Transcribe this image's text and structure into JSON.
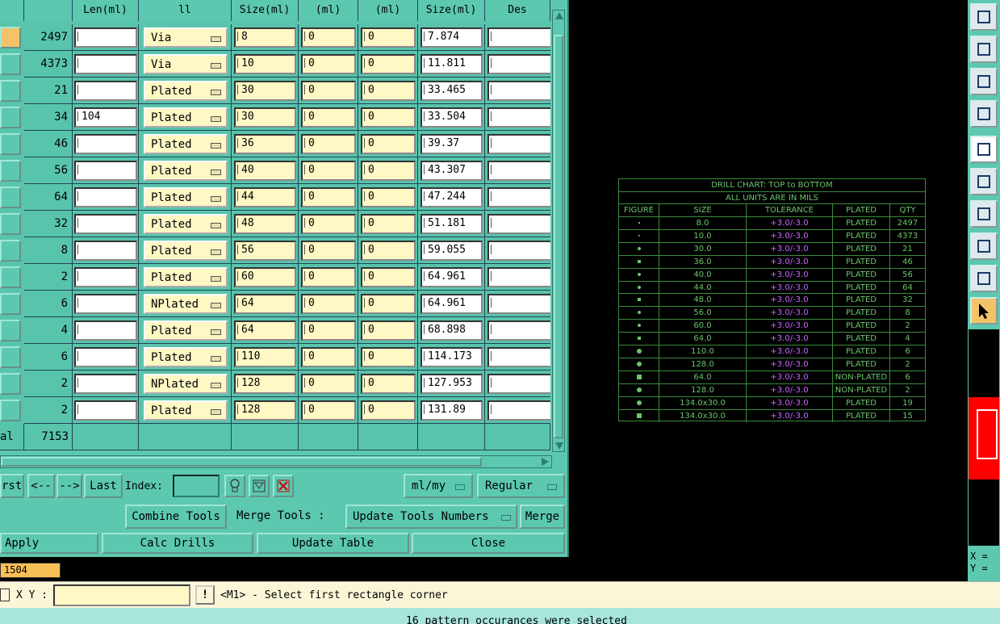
{
  "columns": [
    "",
    "",
    "Len(ml)",
    "ll",
    "Size(ml)",
    "(ml)",
    "(ml)",
    "Size(ml)",
    "Des"
  ],
  "rows": [
    {
      "qty": "2497",
      "len": "",
      "type": "Via",
      "size": "8",
      "tolp": "0",
      "tolm": "0",
      "fin": "7.874",
      "des": ""
    },
    {
      "qty": "4373",
      "len": "",
      "type": "Via",
      "size": "10",
      "tolp": "0",
      "tolm": "0",
      "fin": "11.811",
      "des": ""
    },
    {
      "qty": "21",
      "len": "",
      "type": "Plated",
      "size": "30",
      "tolp": "0",
      "tolm": "0",
      "fin": "33.465",
      "des": ""
    },
    {
      "qty": "34",
      "len": "104",
      "type": "Plated",
      "size": "30",
      "tolp": "0",
      "tolm": "0",
      "fin": "33.504",
      "des": ""
    },
    {
      "qty": "46",
      "len": "",
      "type": "Plated",
      "size": "36",
      "tolp": "0",
      "tolm": "0",
      "fin": "39.37",
      "des": ""
    },
    {
      "qty": "56",
      "len": "",
      "type": "Plated",
      "size": "40",
      "tolp": "0",
      "tolm": "0",
      "fin": "43.307",
      "des": ""
    },
    {
      "qty": "64",
      "len": "",
      "type": "Plated",
      "size": "44",
      "tolp": "0",
      "tolm": "0",
      "fin": "47.244",
      "des": ""
    },
    {
      "qty": "32",
      "len": "",
      "type": "Plated",
      "size": "48",
      "tolp": "0",
      "tolm": "0",
      "fin": "51.181",
      "des": ""
    },
    {
      "qty": "8",
      "len": "",
      "type": "Plated",
      "size": "56",
      "tolp": "0",
      "tolm": "0",
      "fin": "59.055",
      "des": ""
    },
    {
      "qty": "2",
      "len": "",
      "type": "Plated",
      "size": "60",
      "tolp": "0",
      "tolm": "0",
      "fin": "64.961",
      "des": ""
    },
    {
      "qty": "6",
      "len": "",
      "type": "NPlated",
      "size": "64",
      "tolp": "0",
      "tolm": "0",
      "fin": "64.961",
      "des": ""
    },
    {
      "qty": "4",
      "len": "",
      "type": "Plated",
      "size": "64",
      "tolp": "0",
      "tolm": "0",
      "fin": "68.898",
      "des": ""
    },
    {
      "qty": "6",
      "len": "",
      "type": "Plated",
      "size": "110",
      "tolp": "0",
      "tolm": "0",
      "fin": "114.173",
      "des": ""
    },
    {
      "qty": "2",
      "len": "",
      "type": "NPlated",
      "size": "128",
      "tolp": "0",
      "tolm": "0",
      "fin": "127.953",
      "des": ""
    },
    {
      "qty": "2",
      "len": "",
      "type": "Plated",
      "size": "128",
      "tolp": "0",
      "tolm": "0",
      "fin": "131.89",
      "des": ""
    }
  ],
  "total": {
    "label": "al",
    "value": "7153"
  },
  "nav": {
    "first": "rst",
    "prev": "<--",
    "next": "-->",
    "last": "Last",
    "index_label": "Index:",
    "index_value": "",
    "units": "ml/my",
    "mode": "Regular"
  },
  "tools": {
    "combine": "Combine Tools",
    "merge_label": "Merge Tools :",
    "update_numbers": "Update Tools Numbers",
    "merge": "Merge"
  },
  "actions": {
    "apply": "Apply",
    "calc": "Calc Drills",
    "update_table": "Update Table",
    "close": "Close"
  },
  "orange_value": "1504",
  "xy": {
    "label": "X Y :",
    "value": ""
  },
  "prompt": "<M1> - Select first rectangle corner",
  "status": "16 pattern occurances were selected",
  "coords": {
    "x": "X =",
    "y": "Y ="
  },
  "drill_chart": {
    "title1": "DRILL CHART: TOP to BOTTOM",
    "title2": "ALL UNITS ARE IN MILS",
    "headers": [
      "FIGURE",
      "SIZE",
      "TOLERANCE",
      "PLATED",
      "QTY"
    ],
    "rows": [
      {
        "size": "8.0",
        "tol": "+3.0/-3.0",
        "plated": "PLATED",
        "qty": "2497"
      },
      {
        "size": "10.0",
        "tol": "+3.0/-3.0",
        "plated": "PLATED",
        "qty": "4373"
      },
      {
        "size": "30.0",
        "tol": "+3.0/-3.0",
        "plated": "PLATED",
        "qty": "21"
      },
      {
        "size": "36.0",
        "tol": "+3.0/-3.0",
        "plated": "PLATED",
        "qty": "46"
      },
      {
        "size": "40.0",
        "tol": "+3.0/-3.0",
        "plated": "PLATED",
        "qty": "56"
      },
      {
        "size": "44.0",
        "tol": "+3.0/-3.0",
        "plated": "PLATED",
        "qty": "64"
      },
      {
        "size": "48.0",
        "tol": "+3.0/-3.0",
        "plated": "PLATED",
        "qty": "32"
      },
      {
        "size": "56.0",
        "tol": "+3.0/-3.0",
        "plated": "PLATED",
        "qty": "8"
      },
      {
        "size": "60.0",
        "tol": "+3.0/-3.0",
        "plated": "PLATED",
        "qty": "2"
      },
      {
        "size": "64.0",
        "tol": "+3.0/-3.0",
        "plated": "PLATED",
        "qty": "4"
      },
      {
        "size": "110.0",
        "tol": "+3.0/-3.0",
        "plated": "PLATED",
        "qty": "6"
      },
      {
        "size": "128.0",
        "tol": "+3.0/-3.0",
        "plated": "PLATED",
        "qty": "2"
      },
      {
        "size": "64.0",
        "tol": "+3.0/-3.0",
        "plated": "NON-PLATED",
        "qty": "6"
      },
      {
        "size": "128.0",
        "tol": "+3.0/-3.0",
        "plated": "NON-PLATED",
        "qty": "2"
      },
      {
        "size": "134.0x30.0",
        "tol": "+3.0/-3.0",
        "plated": "PLATED",
        "qty": "19"
      },
      {
        "size": "134.0x30.0",
        "tol": "+3.0/-3.0",
        "plated": "PLATED",
        "qty": "15"
      }
    ]
  },
  "toolbar_icons": [
    "export-icon",
    "import-icon",
    "fit-view-icon",
    "settings-icon",
    "shape-icon",
    "nodes-icon",
    "angle-icon",
    "layers-icon",
    "measure-icon",
    "pointer-icon"
  ],
  "colors": {
    "panel": "#5cc8b0",
    "field": "#fff7c4",
    "chart_green": "#6cc46c",
    "tolerance": "#cc66ff",
    "accent": "#f3c36a",
    "alert": "#ff0000"
  }
}
